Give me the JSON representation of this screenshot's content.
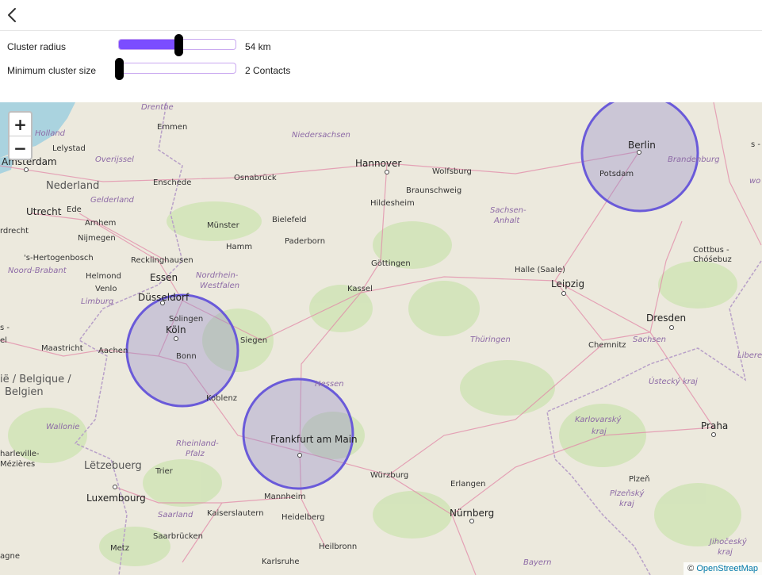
{
  "header": {
    "back_icon": "chevron-left-icon"
  },
  "controls": {
    "cluster_radius": {
      "label": "Cluster radius",
      "value_text": "54 km",
      "level": 0.51,
      "accent": "#7b4dff"
    },
    "min_cluster_size": {
      "label": "Minimum cluster size",
      "value_text": "2 Contacts",
      "level": 0.0
    }
  },
  "map": {
    "zoom_in_label": "+",
    "zoom_out_label": "−",
    "attribution_prefix": "©",
    "attribution_link": "OpenStreetMap",
    "cluster_color": "#6a5ad9",
    "clusters": [
      {
        "name": "Berlin"
      },
      {
        "name": "Köln"
      },
      {
        "name": "Frankfurt am Main"
      }
    ],
    "labels": {
      "drenthe": "Drenthe",
      "emmen": "Emmen",
      "holland": "Holland",
      "lelystad": "Lelystad",
      "overijssel": "Overijssel",
      "niedersachsen": "Niedersachsen",
      "amsterdam": "Amsterdam",
      "nederland": "Nederland",
      "enschede": "Enschede",
      "osnabrueck": "Osnabrück",
      "hannover": "Hannover",
      "wolfsburg": "Wolfsburg",
      "braunschweig": "Braunschweig",
      "hildesheim": "Hildesheim",
      "gelderland": "Gelderland",
      "utrecht": "Utrecht",
      "ede": "Ede",
      "arnhem": "Arnhem",
      "nijmegen": "Nijmegen",
      "bielefeld": "Bielefeld",
      "muenster": "Münster",
      "paderborn": "Paderborn",
      "sachsen_anhalt_1": "Sachsen-",
      "sachsen_anhalt_2": "Anhalt",
      "potsdam": "Potsdam",
      "brandenburg": "Brandenburg",
      "s_hertogenbosch": "'s-Hertogenbosch",
      "recklinghausen": "Recklinghausen",
      "hamm": "Hamm",
      "goettingen": "Göttingen",
      "noord_brabant": "Noord-Brabant",
      "helmond": "Helmond",
      "venlo": "Venlo",
      "essen": "Essen",
      "nrw_1": "Nordrhein-",
      "nrw_2": "Westfalen",
      "kassel": "Kassel",
      "halle": "Halle (Saale)",
      "leipzig": "Leipzig",
      "cottbus_1": "Cottbus -",
      "cottbus_2": "Chóśebuz",
      "limburg": "Limburg",
      "duesseldorf": "Düsseldorf",
      "solingen": "Solingen",
      "dresden": "Dresden",
      "maastricht": "Maastricht",
      "aachen": "Aachen",
      "bonn": "Bonn",
      "siegen": "Siegen",
      "thueringen": "Thüringen",
      "chemnitz": "Chemnitz",
      "sachsen": "Sachsen",
      "liberec": "Libere",
      "belgique_1": "ië / Belgique /",
      "belgique_2": "Belgien",
      "hessen": "Hessen",
      "koblenz": "Koblenz",
      "ustecky": "Ústecký kraj",
      "wallonie": "Wallonie",
      "karlovarsky_1": "Karlovarský",
      "karlovarsky_2": "kraj",
      "rheinland_1": "Rheinland-",
      "rheinland_2": "Pfalz",
      "praha": "Praha",
      "charleville_1": "harleville-",
      "charleville_2": "Mézières",
      "letzebuerg": "Lëtzebuerg",
      "trier": "Trier",
      "wuerzburg": "Würzburg",
      "plzen": "Plzeň",
      "luxembourg": "Luxembourg",
      "erlangen": "Erlangen",
      "plzensky_1": "Plzeňský",
      "plzensky_2": "kraj",
      "mannheim": "Mannheim",
      "saarland": "Saarland",
      "kaiserslautern": "Kaiserslautern",
      "heidelberg": "Heidelberg",
      "nuernberg": "Nürnberg",
      "saarbruecken": "Saarbrücken",
      "jihocesky_1": "Jihočeský",
      "jihocesky_2": "kraj",
      "metz": "Metz",
      "heilbronn": "Heilbronn",
      "agne": "agne",
      "karlsruhe": "Karlsruhe",
      "bayern": "Bayern",
      "wo": "wo",
      "ls": "s -",
      "el": "el",
      "rdrecht": "rdrecht",
      "cht": "cht"
    }
  }
}
